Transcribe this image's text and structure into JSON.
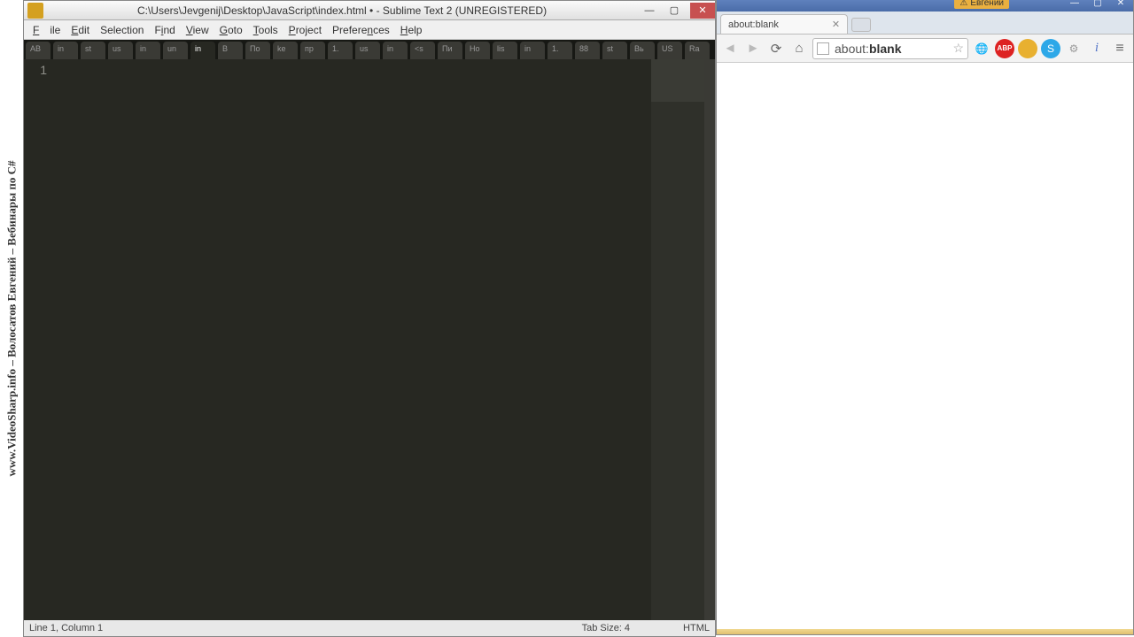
{
  "watermark": "www.VideoSharp.info – Волосатов Евгений – Вебинары по C#",
  "sublime": {
    "title": "C:\\Users\\Jevgenij\\Desktop\\JavaScript\\index.html • - Sublime Text 2 (UNREGISTERED)",
    "menu": {
      "file": "File",
      "edit": "Edit",
      "selection": "Selection",
      "find": "Find",
      "view": "View",
      "goto": "Goto",
      "tools": "Tools",
      "project": "Project",
      "preferences": "Preferences",
      "help": "Help"
    },
    "tabs": [
      "AB",
      "in",
      "st",
      "us",
      "in",
      "un",
      "in",
      "B",
      "По",
      "ke",
      "пр",
      "1.",
      "us",
      "in",
      "<s",
      "Пи",
      "Но",
      "lis",
      "in",
      "1.",
      "88",
      "st",
      "Вь",
      "US",
      "Ra"
    ],
    "active_tab_index": 6,
    "gutter_line": "1",
    "status": {
      "left": "Line 1, Column 1",
      "mid": "Tab Size: 4",
      "right": "HTML"
    }
  },
  "browser": {
    "user": "Евгений",
    "tab_title": "about:blank",
    "url_prefix": "about:",
    "url_suffix": "blank"
  }
}
